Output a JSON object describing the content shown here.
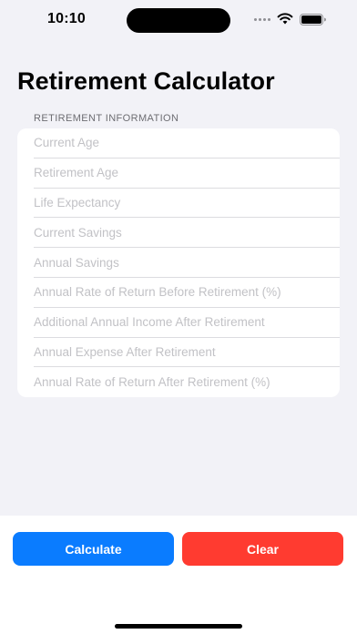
{
  "status_bar": {
    "time": "10:10",
    "icons": [
      "signal-icon",
      "wifi-icon",
      "battery-icon"
    ]
  },
  "title": "Retirement Calculator",
  "section_header": "RETIREMENT INFORMATION",
  "fields": [
    {
      "placeholder": "Current Age",
      "value": ""
    },
    {
      "placeholder": "Retirement Age",
      "value": ""
    },
    {
      "placeholder": "Life Expectancy",
      "value": ""
    },
    {
      "placeholder": "Current Savings",
      "value": ""
    },
    {
      "placeholder": "Annual Savings",
      "value": ""
    },
    {
      "placeholder": "Annual Rate of Return Before Retirement (%)",
      "value": ""
    },
    {
      "placeholder": "Additional Annual Income After Retirement",
      "value": ""
    },
    {
      "placeholder": "Annual Expense After Retirement",
      "value": ""
    },
    {
      "placeholder": "Annual Rate of Return After Retirement (%)",
      "value": ""
    }
  ],
  "buttons": {
    "calculate_label": "Calculate",
    "clear_label": "Clear"
  },
  "colors": {
    "background": "#f2f2f7",
    "calculate": "#0a7cff",
    "clear": "#ff3b30",
    "placeholder": "#c2c2c6"
  }
}
